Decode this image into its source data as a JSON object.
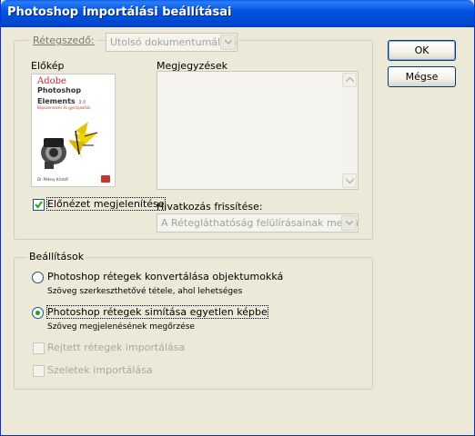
{
  "window": {
    "title": "Photoshop importálási beállításai"
  },
  "layer_comp": {
    "label": "Rétegszedő:",
    "selected": "Utolsó dokumentumállapot"
  },
  "preview": {
    "label": "Előkép",
    "show_preview_label": "Előnézet megjelenítése",
    "show_preview_checked": true,
    "book": {
      "brand": "Adobe",
      "product_line1": "Photoshop",
      "product_line2": "Elements",
      "version": "3.0",
      "subtitle": "Képszervezés és gyorsjavítás",
      "author": "Dr. Pétery Kristóf"
    }
  },
  "notes": {
    "label": "Megjegyzések"
  },
  "link_update": {
    "label": "Hivatkozás frissítése:",
    "selected": "A Rétegláthatóság felülírásainak megtart..."
  },
  "buttons": {
    "ok": "OK",
    "cancel": "Mégse"
  },
  "options": {
    "legend": "Beállítások",
    "convert_label": "Photoshop rétegek konvertálása objektumokká",
    "convert_desc": "Szöveg szerkeszthetővé tétele, ahol lehetséges",
    "flatten_label": "Photoshop rétegek simítása egyetlen képbe",
    "flatten_desc": "Szöveg megjelenésének megőrzése",
    "selected": "flatten",
    "hidden_layers_label": "Rejtett rétegek importálása",
    "slices_label": "Szeletek importálása"
  },
  "colors": {
    "title_bar": "#0054e3",
    "radio_dot": "#21a121",
    "book_red": "#d4232b"
  }
}
